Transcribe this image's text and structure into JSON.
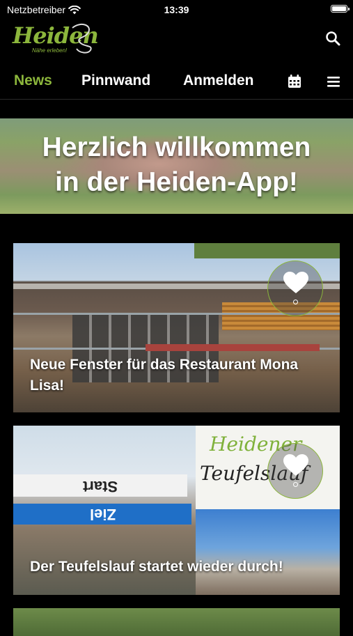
{
  "status_bar": {
    "carrier": "Netzbetreiber",
    "time": "13:39"
  },
  "header": {
    "logo_text": "Heiden",
    "logo_tagline": "Nähe erleben!"
  },
  "nav": {
    "tabs": [
      "News",
      "Pinnwand",
      "Anmelden"
    ],
    "active": "News"
  },
  "hero": {
    "line1": "Herzlich willkommen",
    "line2": "in der Heiden-App!"
  },
  "cards": [
    {
      "title_line1": "Neue Fenster für das Restaurant Mona",
      "title_line2": "Lisa!"
    },
    {
      "title": "Der Teufelslauf startet wieder durch!",
      "banner_start": "Start",
      "banner_ziel": "Ziel",
      "poster_line1": "Heidener",
      "poster_line2": "Teufelslauf"
    }
  ],
  "colors": {
    "accent": "#8cb63c",
    "background": "#000000"
  }
}
